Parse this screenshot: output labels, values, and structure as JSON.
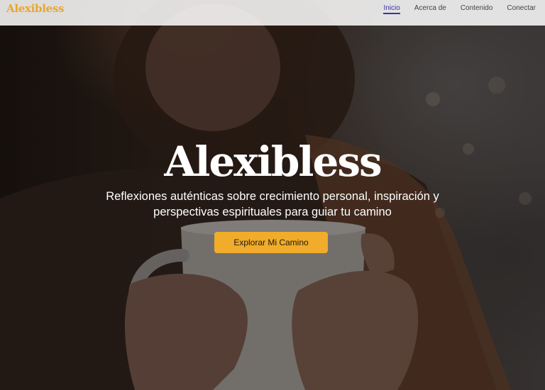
{
  "brand": {
    "logo_text": "Alexibless",
    "accent_color": "#e9a62b"
  },
  "nav": {
    "items": [
      {
        "label": "Inicio",
        "active": true
      },
      {
        "label": "Acerca de",
        "active": false
      },
      {
        "label": "Contenido",
        "active": false
      },
      {
        "label": "Conectar",
        "active": false
      }
    ],
    "active_color": "#3a34a0"
  },
  "hero": {
    "title": "Alexibless",
    "subtitle": "Reflexiones auténticas sobre crecimiento personal, inspiración y perspectivas espirituales para guiar tu camino",
    "cta_label": "Explorar Mi Camino",
    "cta_color": "#f0ac2a"
  }
}
